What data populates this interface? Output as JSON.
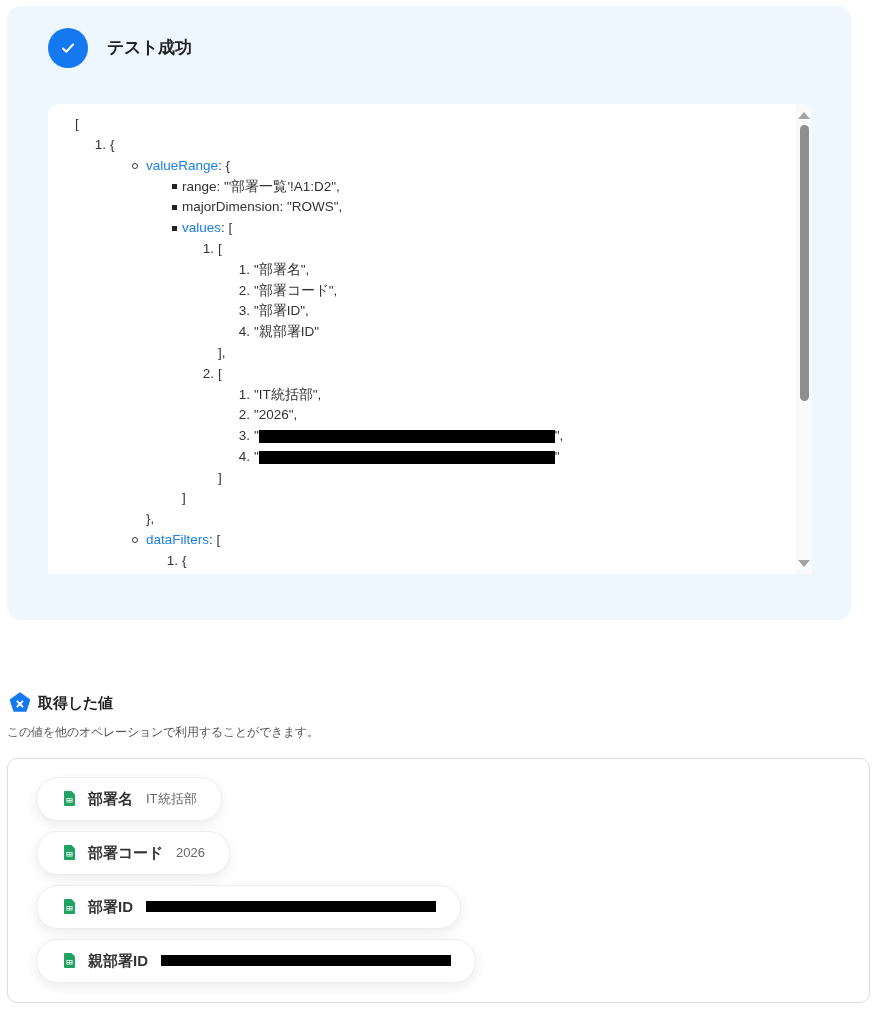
{
  "status": {
    "title": "テスト成功",
    "success": true
  },
  "output": {
    "open": "[",
    "items": [
      {
        "marker": "1.",
        "text": "{",
        "kind": "circle",
        "children": [
          {
            "key": "valueRange",
            "text": ": {",
            "kind": "square",
            "close": "},",
            "children": [
              {
                "text": "range: \"'部署一覧'!A1:D2\","
              },
              {
                "text": "majorDimension: \"ROWS\","
              },
              {
                "key": "values",
                "text": ": [",
                "kind": "ordered",
                "close": "]",
                "children": [
                  {
                    "marker": "1.",
                    "text": "[",
                    "kind": "ordered",
                    "close": "],",
                    "children": [
                      {
                        "marker": "1.",
                        "text": "\"部署名\","
                      },
                      {
                        "marker": "2.",
                        "text": "\"部署コード\","
                      },
                      {
                        "marker": "3.",
                        "text": "\"部署ID\","
                      },
                      {
                        "marker": "4.",
                        "text": "\"親部署ID\""
                      }
                    ]
                  },
                  {
                    "marker": "2.",
                    "text": "[",
                    "kind": "ordered",
                    "close": "]",
                    "children": [
                      {
                        "marker": "1.",
                        "text": "\"IT統括部\","
                      },
                      {
                        "marker": "2.",
                        "text": "\"2026\","
                      },
                      {
                        "marker": "3.",
                        "text": "\"",
                        "redacted": true,
                        "after": "\","
                      },
                      {
                        "marker": "4.",
                        "text": "\"",
                        "redacted": true,
                        "after": "\""
                      }
                    ]
                  }
                ]
              }
            ]
          },
          {
            "key": "dataFilters",
            "text": ": [",
            "kind": "ordered",
            "children": [
              {
                "marker": "1.",
                "text": "{"
              }
            ]
          }
        ]
      }
    ]
  },
  "values_section": {
    "title": "取得した値",
    "description": "この値を他のオペレーションで利用することができます。",
    "chips": [
      {
        "label": "部署名",
        "value": "IT統括部",
        "redacted": false
      },
      {
        "label": "部署コード",
        "value": "2026",
        "redacted": false
      },
      {
        "label": "部署ID",
        "redacted": true
      },
      {
        "label": "親部署ID",
        "redacted": true
      }
    ]
  }
}
